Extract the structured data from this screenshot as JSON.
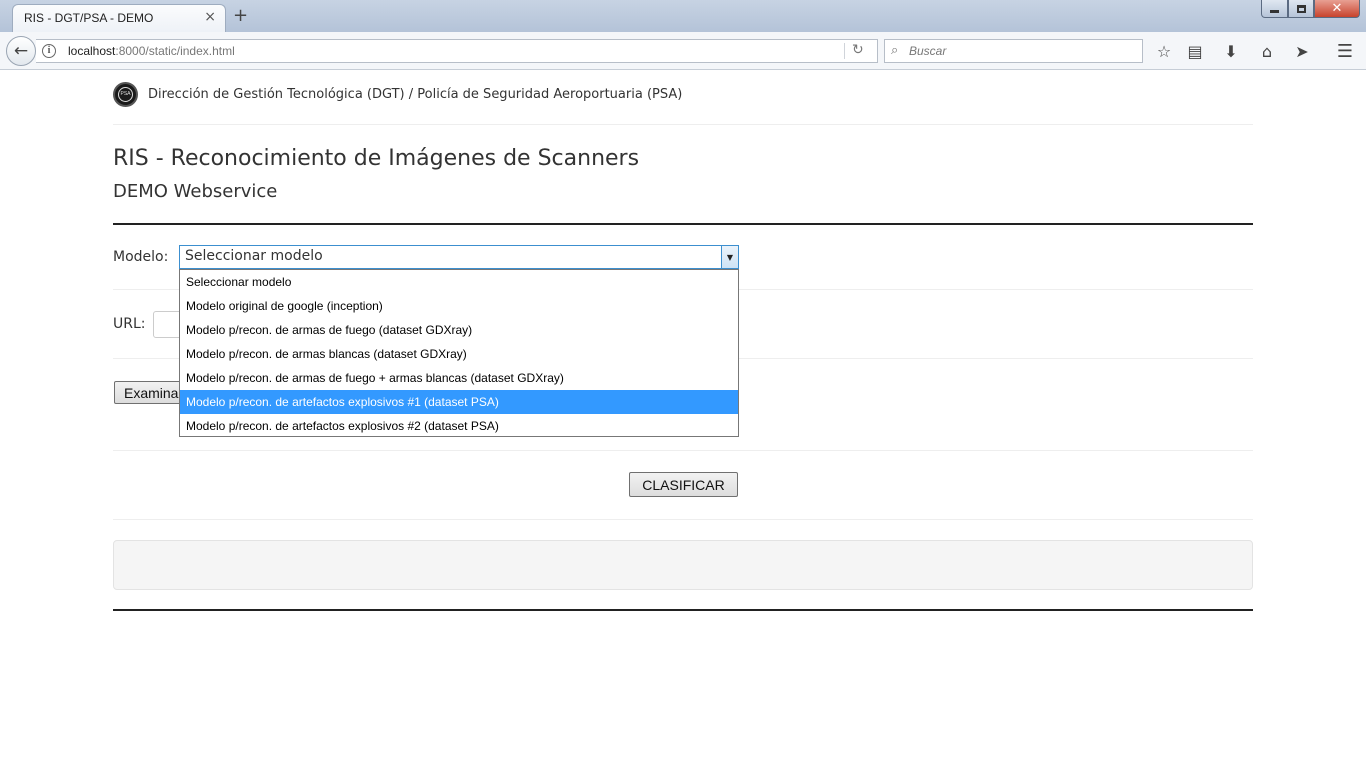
{
  "browser": {
    "tab_title": "RIS - DGT/PSA - DEMO",
    "tab_close": "×",
    "new_tab": "+",
    "url_host": "localhost",
    "url_rest": ":8000/static/index.html",
    "search_placeholder": "Buscar",
    "window_close": "✕"
  },
  "header": {
    "logo_text": "PSA",
    "brand": "Dirección de Gestión Tecnológica (DGT) / Policía de Seguridad Aeroportuaria (PSA)"
  },
  "main": {
    "title": "RIS - Reconocimiento de Imágenes de Scanners",
    "subtitle": "DEMO Webservice"
  },
  "form": {
    "model_label": "Modelo:",
    "model_selected": "Seleccionar modelo",
    "model_options": [
      "Seleccionar modelo",
      "Modelo original de google (inception)",
      "Modelo p/recon. de armas de fuego (dataset GDXray)",
      "Modelo p/recon. de armas blancas (dataset GDXray)",
      "Modelo p/recon. de armas de fuego + armas blancas (dataset GDXray)",
      "Modelo p/recon. de artefactos explosivos #1 (dataset PSA)",
      "Modelo p/recon. de artefactos explosivos #2 (dataset PSA)"
    ],
    "highlighted_option_index": 5,
    "url_label": "URL:",
    "file_button": "Examinar...",
    "classify_button": "CLASIFICAR"
  }
}
